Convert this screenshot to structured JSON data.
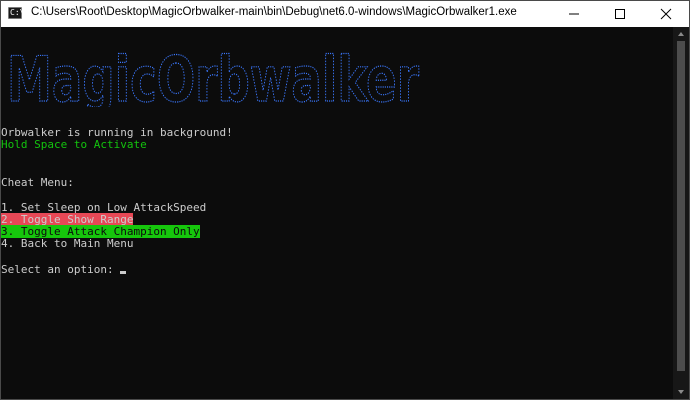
{
  "window": {
    "title": "C:\\Users\\Root\\Desktop\\MagicOrbwalker-main\\bin\\Debug\\net6.0-windows\\MagicOrbwalker1.exe",
    "controls": [
      "minimize-icon",
      "maximize-icon",
      "close-icon"
    ]
  },
  "banner": {
    "text": "MagicOrbwalker",
    "color": "#3b78ff"
  },
  "console": {
    "status_line": "Orbwalker is running in background!",
    "hint_line": "Hold Space to Activate",
    "menu_title": "Cheat Menu:",
    "options": [
      "1. Set Sleep on Low AttackSpeed",
      "2. Toggle Show Range",
      "3. Toggle Attack Champion Only",
      "4. Back to Main Menu"
    ],
    "prompt": "Select an option: "
  },
  "colors": {
    "background": "#0c0c0c",
    "text": "#cccccc",
    "hint_green": "#13c30e",
    "option2_highlight": "#e74856",
    "option3_highlight": "#16c60c"
  }
}
